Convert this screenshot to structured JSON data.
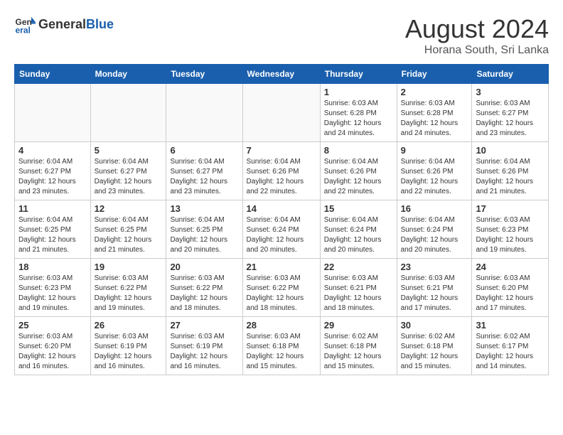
{
  "logo": {
    "line1": "General",
    "line2": "Blue"
  },
  "title": "August 2024",
  "location": "Horana South, Sri Lanka",
  "weekdays": [
    "Sunday",
    "Monday",
    "Tuesday",
    "Wednesday",
    "Thursday",
    "Friday",
    "Saturday"
  ],
  "weeks": [
    [
      {
        "day": "",
        "info": ""
      },
      {
        "day": "",
        "info": ""
      },
      {
        "day": "",
        "info": ""
      },
      {
        "day": "",
        "info": ""
      },
      {
        "day": "1",
        "info": "Sunrise: 6:03 AM\nSunset: 6:28 PM\nDaylight: 12 hours\nand 24 minutes."
      },
      {
        "day": "2",
        "info": "Sunrise: 6:03 AM\nSunset: 6:28 PM\nDaylight: 12 hours\nand 24 minutes."
      },
      {
        "day": "3",
        "info": "Sunrise: 6:03 AM\nSunset: 6:27 PM\nDaylight: 12 hours\nand 23 minutes."
      }
    ],
    [
      {
        "day": "4",
        "info": "Sunrise: 6:04 AM\nSunset: 6:27 PM\nDaylight: 12 hours\nand 23 minutes."
      },
      {
        "day": "5",
        "info": "Sunrise: 6:04 AM\nSunset: 6:27 PM\nDaylight: 12 hours\nand 23 minutes."
      },
      {
        "day": "6",
        "info": "Sunrise: 6:04 AM\nSunset: 6:27 PM\nDaylight: 12 hours\nand 23 minutes."
      },
      {
        "day": "7",
        "info": "Sunrise: 6:04 AM\nSunset: 6:26 PM\nDaylight: 12 hours\nand 22 minutes."
      },
      {
        "day": "8",
        "info": "Sunrise: 6:04 AM\nSunset: 6:26 PM\nDaylight: 12 hours\nand 22 minutes."
      },
      {
        "day": "9",
        "info": "Sunrise: 6:04 AM\nSunset: 6:26 PM\nDaylight: 12 hours\nand 22 minutes."
      },
      {
        "day": "10",
        "info": "Sunrise: 6:04 AM\nSunset: 6:26 PM\nDaylight: 12 hours\nand 21 minutes."
      }
    ],
    [
      {
        "day": "11",
        "info": "Sunrise: 6:04 AM\nSunset: 6:25 PM\nDaylight: 12 hours\nand 21 minutes."
      },
      {
        "day": "12",
        "info": "Sunrise: 6:04 AM\nSunset: 6:25 PM\nDaylight: 12 hours\nand 21 minutes."
      },
      {
        "day": "13",
        "info": "Sunrise: 6:04 AM\nSunset: 6:25 PM\nDaylight: 12 hours\nand 20 minutes."
      },
      {
        "day": "14",
        "info": "Sunrise: 6:04 AM\nSunset: 6:24 PM\nDaylight: 12 hours\nand 20 minutes."
      },
      {
        "day": "15",
        "info": "Sunrise: 6:04 AM\nSunset: 6:24 PM\nDaylight: 12 hours\nand 20 minutes."
      },
      {
        "day": "16",
        "info": "Sunrise: 6:04 AM\nSunset: 6:24 PM\nDaylight: 12 hours\nand 20 minutes."
      },
      {
        "day": "17",
        "info": "Sunrise: 6:03 AM\nSunset: 6:23 PM\nDaylight: 12 hours\nand 19 minutes."
      }
    ],
    [
      {
        "day": "18",
        "info": "Sunrise: 6:03 AM\nSunset: 6:23 PM\nDaylight: 12 hours\nand 19 minutes."
      },
      {
        "day": "19",
        "info": "Sunrise: 6:03 AM\nSunset: 6:22 PM\nDaylight: 12 hours\nand 19 minutes."
      },
      {
        "day": "20",
        "info": "Sunrise: 6:03 AM\nSunset: 6:22 PM\nDaylight: 12 hours\nand 18 minutes."
      },
      {
        "day": "21",
        "info": "Sunrise: 6:03 AM\nSunset: 6:22 PM\nDaylight: 12 hours\nand 18 minutes."
      },
      {
        "day": "22",
        "info": "Sunrise: 6:03 AM\nSunset: 6:21 PM\nDaylight: 12 hours\nand 18 minutes."
      },
      {
        "day": "23",
        "info": "Sunrise: 6:03 AM\nSunset: 6:21 PM\nDaylight: 12 hours\nand 17 minutes."
      },
      {
        "day": "24",
        "info": "Sunrise: 6:03 AM\nSunset: 6:20 PM\nDaylight: 12 hours\nand 17 minutes."
      }
    ],
    [
      {
        "day": "25",
        "info": "Sunrise: 6:03 AM\nSunset: 6:20 PM\nDaylight: 12 hours\nand 16 minutes."
      },
      {
        "day": "26",
        "info": "Sunrise: 6:03 AM\nSunset: 6:19 PM\nDaylight: 12 hours\nand 16 minutes."
      },
      {
        "day": "27",
        "info": "Sunrise: 6:03 AM\nSunset: 6:19 PM\nDaylight: 12 hours\nand 16 minutes."
      },
      {
        "day": "28",
        "info": "Sunrise: 6:03 AM\nSunset: 6:18 PM\nDaylight: 12 hours\nand 15 minutes."
      },
      {
        "day": "29",
        "info": "Sunrise: 6:02 AM\nSunset: 6:18 PM\nDaylight: 12 hours\nand 15 minutes."
      },
      {
        "day": "30",
        "info": "Sunrise: 6:02 AM\nSunset: 6:18 PM\nDaylight: 12 hours\nand 15 minutes."
      },
      {
        "day": "31",
        "info": "Sunrise: 6:02 AM\nSunset: 6:17 PM\nDaylight: 12 hours\nand 14 minutes."
      }
    ]
  ]
}
